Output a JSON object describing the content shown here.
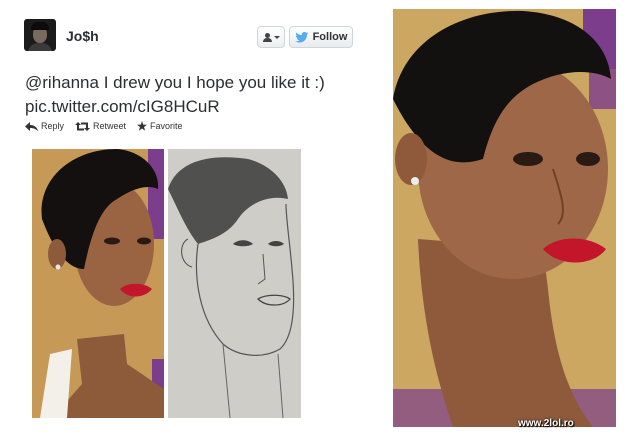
{
  "tweet": {
    "username": "Jo$h",
    "follow_label": "Follow",
    "text_line1": "@rihanna I drew you I hope you like it :)",
    "text_line2": "pic.twitter.com/cIG8HCuR",
    "actions": {
      "reply": "Reply",
      "retweet": "Retweet",
      "favorite": "Favorite"
    }
  },
  "watermark": "www.2lol.ro",
  "colors": {
    "twitter_blue": "#55acee",
    "lip_red": "#c4162a",
    "mtv_purple": "#7b3d8c",
    "backdrop_gold": "#c9a35d"
  },
  "icons": {
    "user_actions": "person-icon",
    "follow": "twitter-bird-icon",
    "reply": "reply-arrow-icon",
    "retweet": "retweet-icon",
    "favorite": "star-icon"
  }
}
